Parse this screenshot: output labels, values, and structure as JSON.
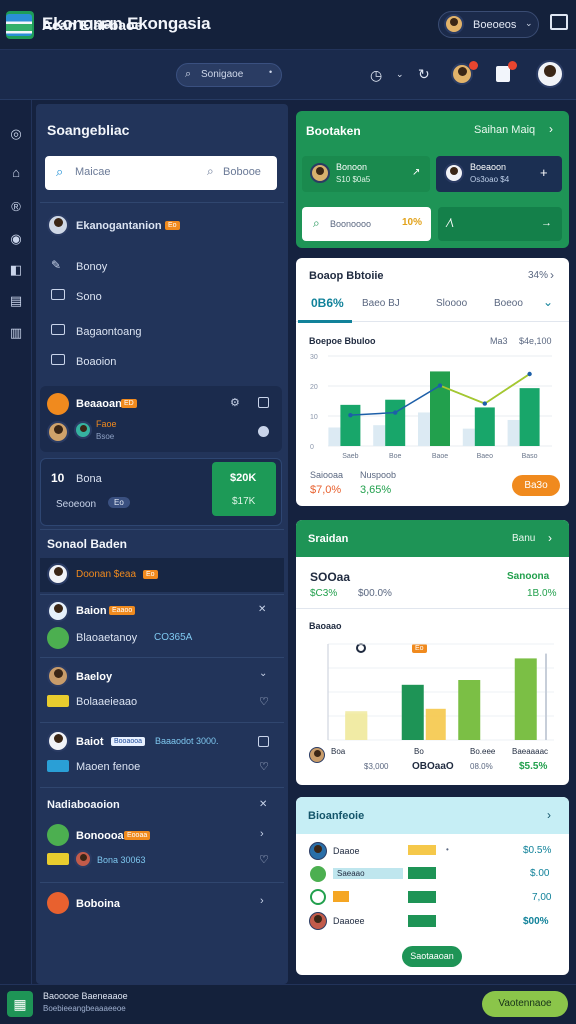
{
  "topbar": {
    "title": "Ekononan Ekongasia",
    "user_label": "Boeoeos"
  },
  "subbar": {
    "title": "Aean ElaFbaoe",
    "search_placeholder": "Sonigaoe"
  },
  "sidebar": {
    "title": "Soangebliac",
    "search_placeholder": "Maicae",
    "search_hint": "Bobooe",
    "profile_name": "Ekanogantanion",
    "profile_tag": "Eo",
    "menu": [
      {
        "label": "Bonoy",
        "icon": "edit-icon"
      },
      {
        "label": "Sono",
        "icon": "image-icon"
      },
      {
        "label": "Bagaontoang",
        "icon": "card-icon"
      },
      {
        "label": "Boaoion",
        "icon": "list-icon"
      }
    ],
    "card1": {
      "title": "Beaaoan",
      "tag": "ED",
      "line1": "Faoe",
      "line2": "Bsoe"
    },
    "card2": {
      "left_num": "10",
      "left_label": "Bona",
      "sub": "Seoeoon",
      "sub_tag": "Eo",
      "btn_top": "$20K",
      "btn_bottom": "$17K"
    },
    "section": {
      "title": "Sonaol Baden"
    },
    "sel_row": {
      "text": "Doonan $eaa",
      "tag": "Eo"
    },
    "rows": [
      {
        "name": "Baion",
        "tag": "Eaaoo",
        "sub": "Blaoaetanoy",
        "sub_value": "CO365A"
      },
      {
        "name": "Baeloy",
        "sub": "Bolaaeieaao"
      },
      {
        "name": "Baiot",
        "tag": "Booaooa",
        "tag2": "Baaaodot 3000.",
        "sub": "Maoen fenoe"
      }
    ],
    "section2": {
      "title": "Nadiaboaoion"
    },
    "rows2": [
      {
        "name": "Bonoooan",
        "tag": "Eooaa",
        "sub": "Bona 30063"
      },
      {
        "name": "Boboina"
      }
    ]
  },
  "cards": {
    "top": {
      "title": "Bootaken",
      "link": "Saihan Maiq",
      "tile1": {
        "name": "Bonoon",
        "value": "S10 $0a5"
      },
      "tile2": {
        "name": "Boeaoon",
        "value": "Os3oao $4"
      },
      "input_text": "Boonoooo",
      "input_value": "10%"
    },
    "chart": {
      "title": "Boaop Bbtoiie",
      "title_value": "34%",
      "tabs": [
        "0B6%",
        "Baeo BJ",
        "Sloooo",
        "Boeoo"
      ],
      "heading": "Boepoe Bbuloo",
      "legend_a": "Ma3",
      "legend_b": "$4e,100",
      "stat1_label": "Saiooaa",
      "stat1_value": "$7,0%",
      "stat2_label": "Nuspoob",
      "stat2_value": "3,65%",
      "button": "Ba3o"
    },
    "chart2": {
      "header": "Sraidan",
      "header_link": "Banu",
      "big": "SOOaa",
      "big_right": "Sanoona",
      "sub_left": "$C3%",
      "sub_mid": "$00.0%",
      "sub_right": "1B.0%",
      "label": "Baoaao",
      "legend_tag": "Eo",
      "foot1_label": "Boa",
      "foot1_value": "$3,000",
      "foot2_label": "Bo",
      "foot2_value": "OBOaaO",
      "foot3_label": "Bo.eee",
      "foot3_value": "08.0%",
      "foot4_label": "Baeaaaac",
      "foot4_value": "$5.5%"
    },
    "list": {
      "title": "Bioanfeoie",
      "rows": [
        {
          "name": "Daaoe",
          "value": "$0.5%"
        },
        {
          "name": "Saeaao",
          "value": "$.00"
        },
        {
          "name": "",
          "value": "7,00"
        },
        {
          "name": "Daaoee",
          "value": "$00%"
        }
      ],
      "button": "Saotaaoan"
    }
  },
  "footer": {
    "line1": "Baooooe Baeneaaoe",
    "line2": "Boebieeangbeaaaeeoe",
    "button": "Vaotennaoe"
  },
  "chart_data": [
    {
      "type": "bar",
      "categories": [
        "Saeb",
        "Boe",
        "Baoe",
        "Baeo",
        "Baso"
      ],
      "series": [
        {
          "values": [
            32,
            36,
            58,
            30,
            45
          ]
        }
      ],
      "line": [
        24,
        26,
        47,
        33,
        56
      ],
      "ylim": [
        0,
        70
      ]
    },
    {
      "type": "bar",
      "categories": [
        "Boa",
        "Bo",
        "Bo.eee",
        "Baeaaaac"
      ],
      "series": [
        {
          "values": [
            22,
            46,
            50,
            68
          ]
        },
        {
          "values": [
            24,
            26
          ]
        }
      ],
      "ylim": [
        0,
        80
      ]
    }
  ]
}
